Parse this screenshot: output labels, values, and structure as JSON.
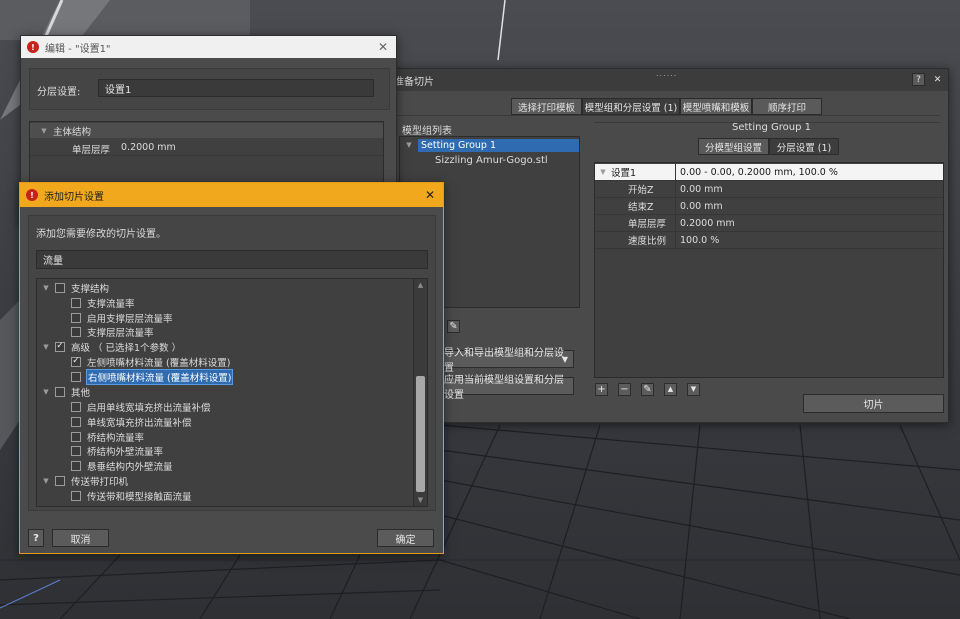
{
  "slice_window": {
    "title": "准备切片",
    "drag_handle": "......",
    "help_label": "?",
    "close_label": "✕",
    "tabs": [
      "选择打印模板",
      "模型组和分层设置 (1)",
      "模型喷嘴和模板",
      "顺序打印"
    ],
    "model_group_list_label": "模型组列表",
    "tree": {
      "group": "Setting Group 1",
      "file": "Sizzling Amur-Gogo.stl"
    },
    "import_export_dropdown": "导入和导出模型组和分层设置",
    "apply_button": "应用当前模型组设置和分层设置",
    "setting_group_title": "Setting Group 1",
    "sub_tabs": [
      "分模型组设置",
      "分层设置 (1)"
    ],
    "table": [
      {
        "key": "设置1",
        "value": "0.00 - 0.00, 0.2000 mm, 100.0 %"
      },
      {
        "key": "开始Z",
        "value": "0.00 mm"
      },
      {
        "key": "结束Z",
        "value": "0.00 mm"
      },
      {
        "key": "单层层厚",
        "value": "0.2000 mm"
      },
      {
        "key": "速度比例",
        "value": "100.0 %"
      }
    ],
    "slice_button": "切片"
  },
  "edit_window": {
    "title": "编辑 - \"设置1\"",
    "close_label": "✕",
    "layer_setting_label": "分层设置:",
    "layer_setting_value": "设置1",
    "section": "主体结构",
    "layer_thickness_label": "单层层厚",
    "layer_thickness_value": "0.2000 mm"
  },
  "add_dialog": {
    "title": "添加切片设置",
    "close_label": "✕",
    "instruction": "添加您需要修改的切片设置。",
    "search_value": "流量",
    "items": [
      {
        "level": 0,
        "label": "支撑结构",
        "checked": false,
        "expanded": true
      },
      {
        "level": 1,
        "label": "支撑流量率",
        "checked": false
      },
      {
        "level": 1,
        "label": "启用支撑层层流量率",
        "checked": false
      },
      {
        "level": 1,
        "label": "支撑层层流量率",
        "checked": false
      },
      {
        "level": 0,
        "label": "高级 （ 已选择1个参数 ）",
        "checked": true,
        "expanded": true
      },
      {
        "level": 1,
        "label": "左侧喷嘴材料流量 (覆盖材料设置)",
        "checked": true
      },
      {
        "level": 1,
        "label": "右侧喷嘴材料流量 (覆盖材料设置)",
        "checked": false,
        "highlighted": true
      },
      {
        "level": 0,
        "label": "其他",
        "checked": false,
        "expanded": true
      },
      {
        "level": 1,
        "label": "启用单线宽填充挤出流量补偿",
        "checked": false
      },
      {
        "level": 1,
        "label": "单线宽填充挤出流量补偿",
        "checked": false
      },
      {
        "level": 1,
        "label": "桥结构流量率",
        "checked": false
      },
      {
        "level": 1,
        "label": "桥结构外壁流量率",
        "checked": false
      },
      {
        "level": 1,
        "label": "悬垂结构内外壁流量",
        "checked": false
      },
      {
        "level": 0,
        "label": "传送带打印机",
        "checked": false,
        "expanded": true
      },
      {
        "level": 1,
        "label": "传送带和模型接触面流量",
        "checked": false
      }
    ],
    "help_label": "?",
    "cancel_button": "取消",
    "ok_button": "确定"
  },
  "colors": {
    "accent": "#f2a81c",
    "selection": "#2f6bb0",
    "app_icon": "#c8221c"
  }
}
